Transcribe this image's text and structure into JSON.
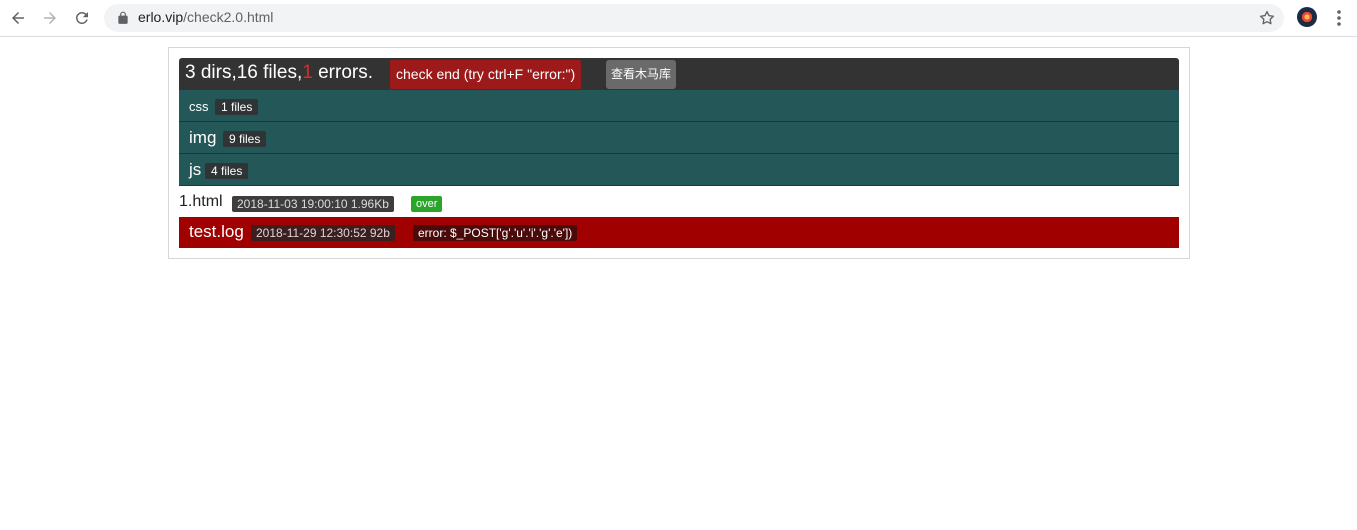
{
  "browser": {
    "url_host": "erlo.vip",
    "url_path": "/check2.0.html",
    "icons": [
      "back-icon",
      "forward-icon",
      "reload-icon",
      "lock-icon",
      "star-icon",
      "extension-icon",
      "menu-icon"
    ]
  },
  "summary": {
    "prefix": "3 dirs,16 files,",
    "error_count": "1",
    "suffix": " errors.",
    "check_end_label": "check end (try ctrl+F \"error:\")",
    "view_button_label": "查看木马库"
  },
  "dirs": [
    {
      "name": "css",
      "count": "1 files"
    },
    {
      "name": "img",
      "count": "9 files"
    },
    {
      "name": "js",
      "count": "4 files"
    }
  ],
  "files": [
    {
      "name": "1.html",
      "meta": "2018-11-03 19:00:10  1.96Kb",
      "status": "over"
    }
  ],
  "error_files": [
    {
      "name": "test.log",
      "meta": "2018-11-29 12:30:52  92b",
      "error": "error: $_POST['g'.'u'.'i'.'g'.'e'])"
    }
  ],
  "colors": {
    "summary_bg": "#333333",
    "dir_bg": "#245757",
    "error_bg": "#a00000",
    "ok_badge": "#2aa52a"
  }
}
